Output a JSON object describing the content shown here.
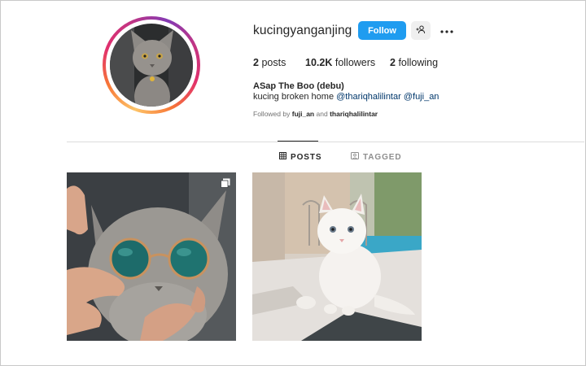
{
  "profile": {
    "username": "kucingyanganjing",
    "follow_label": "Follow",
    "stats": {
      "posts_count": "2",
      "posts_label": "posts",
      "followers_count": "10.2K",
      "followers_label": "followers",
      "following_count": "2",
      "following_label": "following"
    },
    "full_name": "ASap The Boo (debu)",
    "bio_text": "kucing broken home",
    "bio_mentions": [
      "@thariqhalilintar",
      "@fuji_an"
    ],
    "followed_by": {
      "prefix": "Followed by",
      "user1": "fuji_an",
      "joiner": "and",
      "user2": "thariqhalilintar"
    }
  },
  "tabs": [
    {
      "label": "POSTS",
      "icon": "grid-icon",
      "active": true
    },
    {
      "label": "TAGGED",
      "icon": "tag-icon",
      "active": false
    }
  ],
  "posts": [
    {
      "description_icon": "multiple-images-icon"
    },
    {}
  ],
  "colors": {
    "follow_button": "#1f9cf0",
    "link": "#00376b",
    "active_tab": "#262626",
    "inactive_tab": "#8e8e8e"
  }
}
